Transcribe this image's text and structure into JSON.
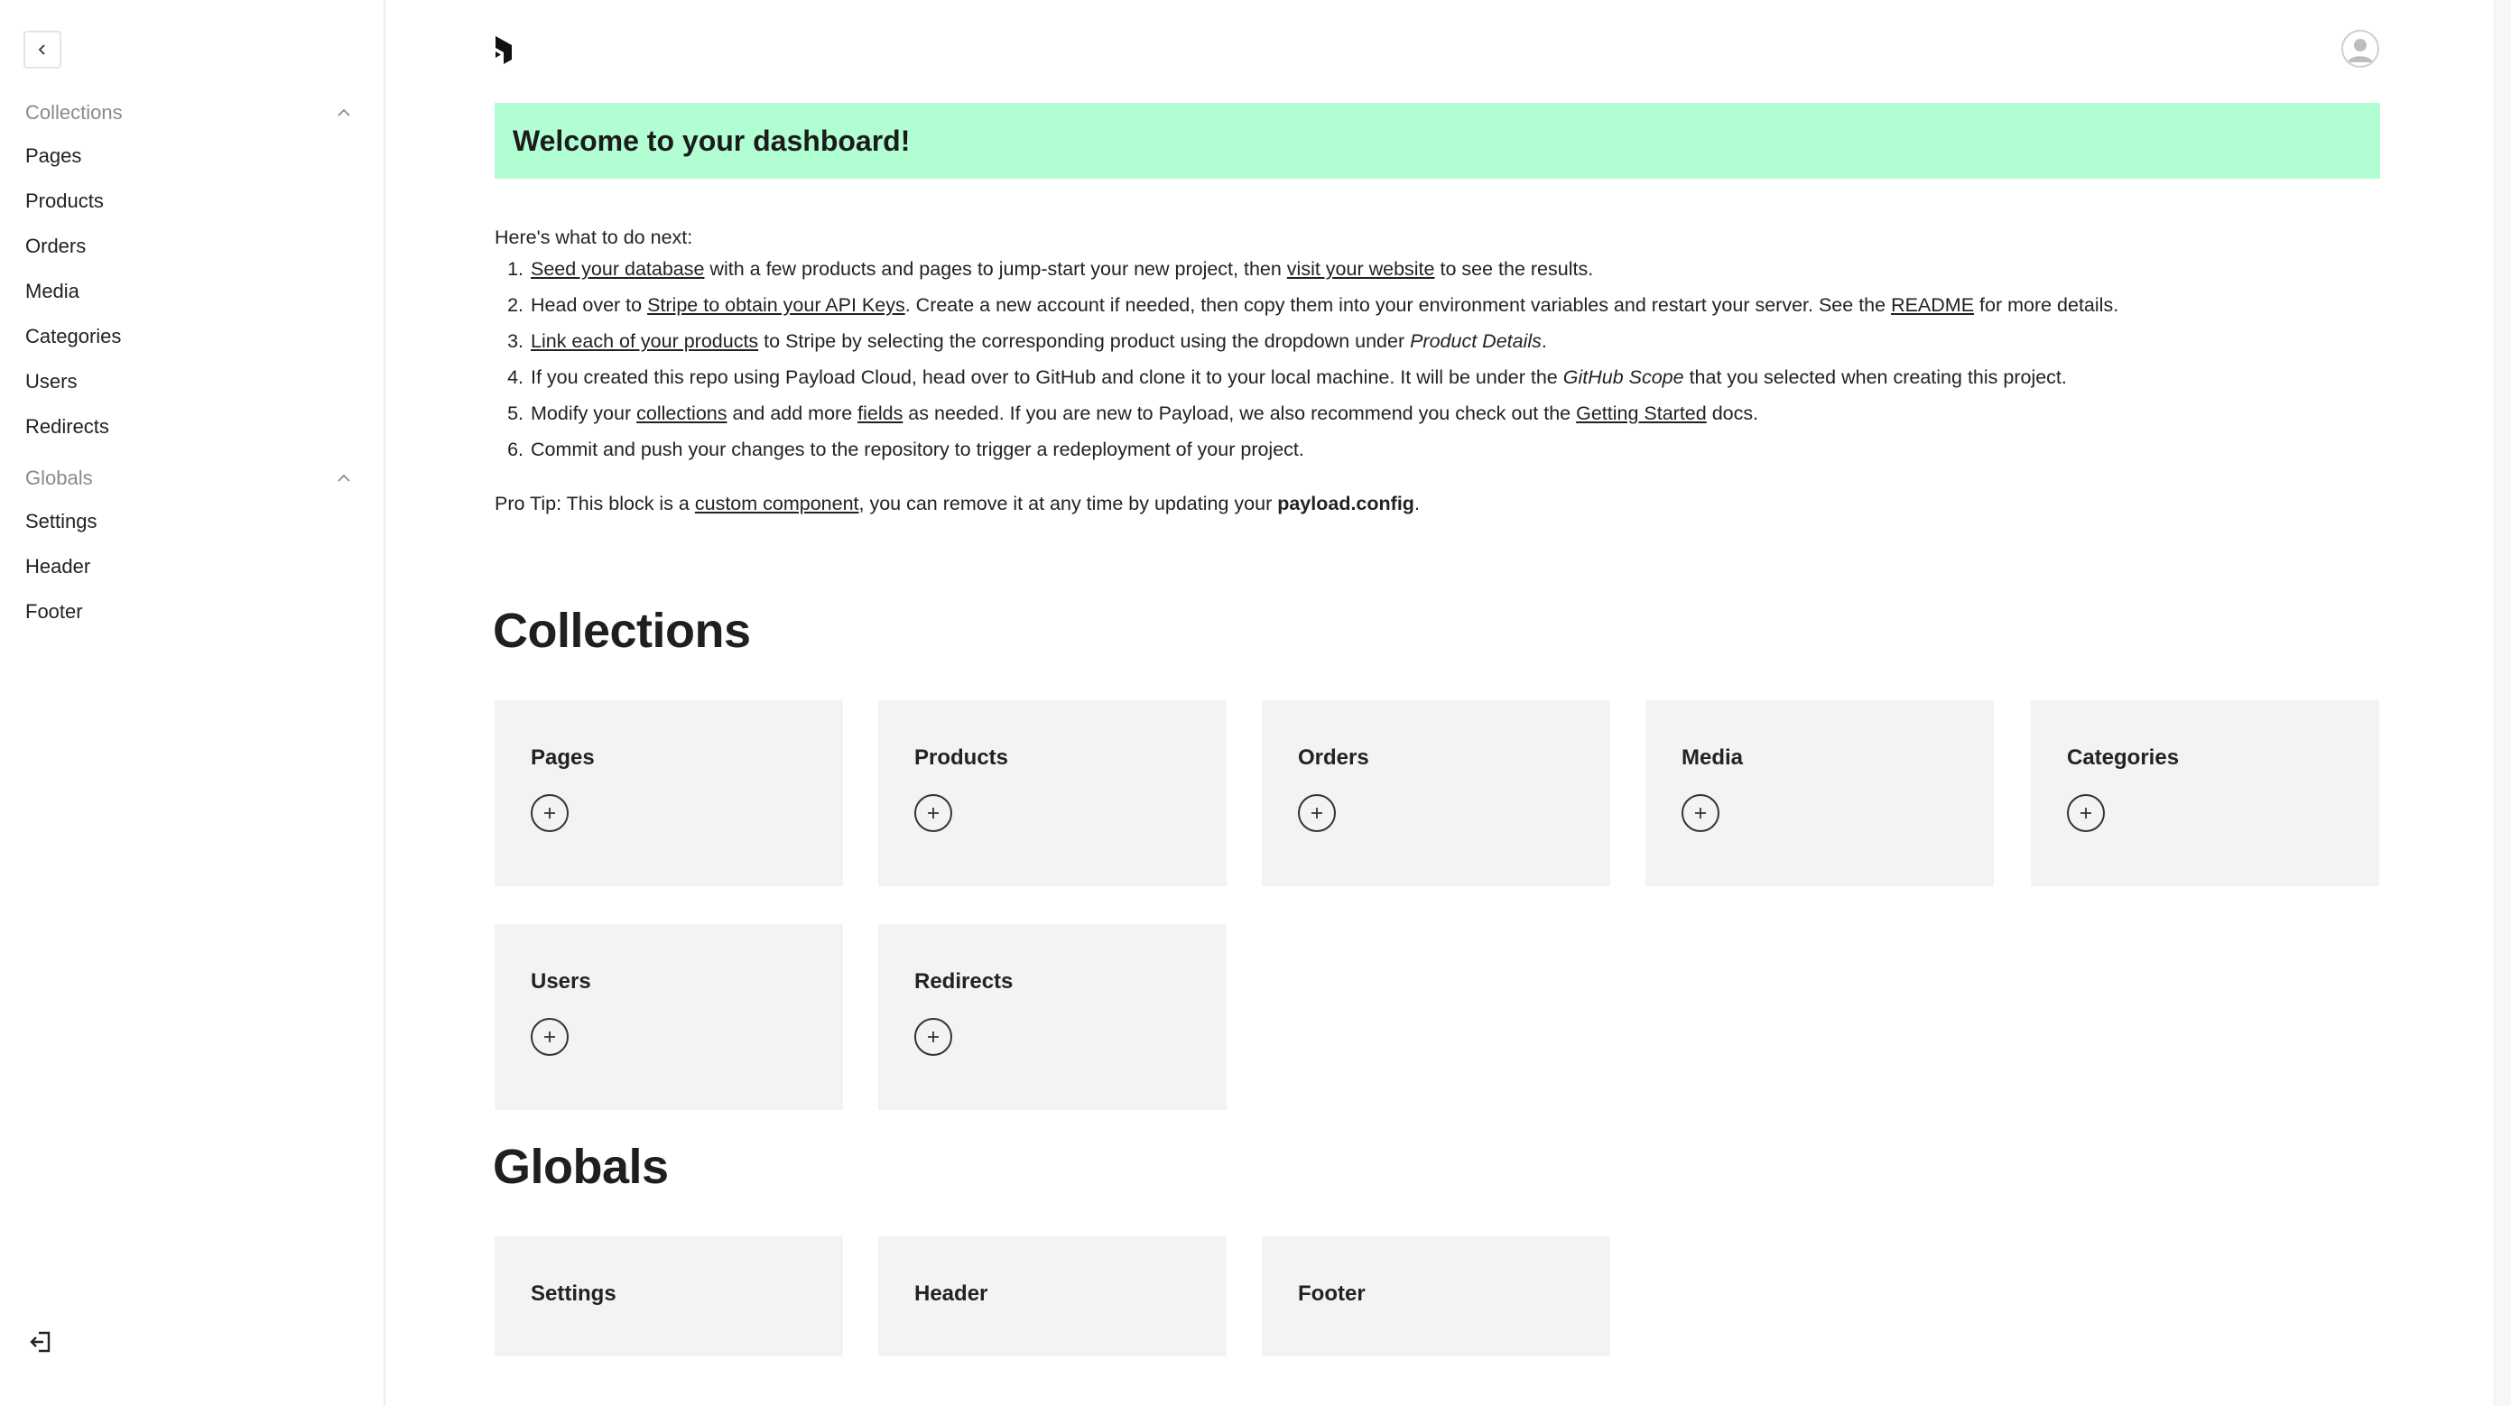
{
  "sidebar": {
    "groups": [
      {
        "label": "Collections",
        "items": [
          "Pages",
          "Products",
          "Orders",
          "Media",
          "Categories",
          "Users",
          "Redirects"
        ]
      },
      {
        "label": "Globals",
        "items": [
          "Settings",
          "Header",
          "Footer"
        ]
      }
    ]
  },
  "banner": {
    "title": "Welcome to your dashboard!"
  },
  "intro": "Here's what to do next:",
  "steps": [
    {
      "num": "1.",
      "parts": [
        {
          "t": "Seed your database",
          "link": true
        },
        {
          "t": " with a few products and pages to jump-start your new project, then "
        },
        {
          "t": "visit your website",
          "link": true
        },
        {
          "t": " to see the results."
        }
      ]
    },
    {
      "num": "2.",
      "parts": [
        {
          "t": "Head over to "
        },
        {
          "t": "Stripe to obtain your API Keys",
          "link": true
        },
        {
          "t": ". Create a new account if needed, then copy them into your environment variables and restart your server. See the "
        },
        {
          "t": "README",
          "link": true
        },
        {
          "t": " for more details."
        }
      ]
    },
    {
      "num": "3.",
      "parts": [
        {
          "t": "Link each of your products",
          "link": true
        },
        {
          "t": " to Stripe by selecting the corresponding product using the dropdown under "
        },
        {
          "t": "Product Details",
          "italic": true
        },
        {
          "t": "."
        }
      ]
    },
    {
      "num": "4.",
      "parts": [
        {
          "t": "If you created this repo using Payload Cloud, head over to GitHub and clone it to your local machine. It will be under the "
        },
        {
          "t": "GitHub Scope",
          "italic": true
        },
        {
          "t": " that you selected when creating this project."
        }
      ]
    },
    {
      "num": "5.",
      "parts": [
        {
          "t": "Modify your "
        },
        {
          "t": "collections",
          "link": true
        },
        {
          "t": " and add more "
        },
        {
          "t": "fields",
          "link": true
        },
        {
          "t": " as needed. If you are new to Payload, we also recommend you check out the "
        },
        {
          "t": "Getting Started",
          "link": true
        },
        {
          "t": " docs."
        }
      ]
    },
    {
      "num": "6.",
      "parts": [
        {
          "t": "Commit and push your changes to the repository to trigger a redeployment of your project."
        }
      ]
    }
  ],
  "protip": {
    "prefix": "Pro Tip: This block is a ",
    "link": "custom component",
    "middle": ", you can remove it at any time by updating your ",
    "bold": "payload.config",
    "suffix": "."
  },
  "collections_title": "Collections",
  "collections": [
    "Pages",
    "Products",
    "Orders",
    "Media",
    "Categories",
    "Users",
    "Redirects"
  ],
  "globals_title": "Globals",
  "globals": [
    "Settings",
    "Header",
    "Footer"
  ],
  "colors": {
    "banner": "#b2fed3",
    "card": "#f3f3f3"
  },
  "icons": {
    "collapse": "chevron-left-icon",
    "group_toggle": "chevron-up-icon",
    "logout": "logout-icon",
    "logo": "payload-logo-icon",
    "avatar": "user-avatar-icon",
    "add": "plus-icon"
  }
}
